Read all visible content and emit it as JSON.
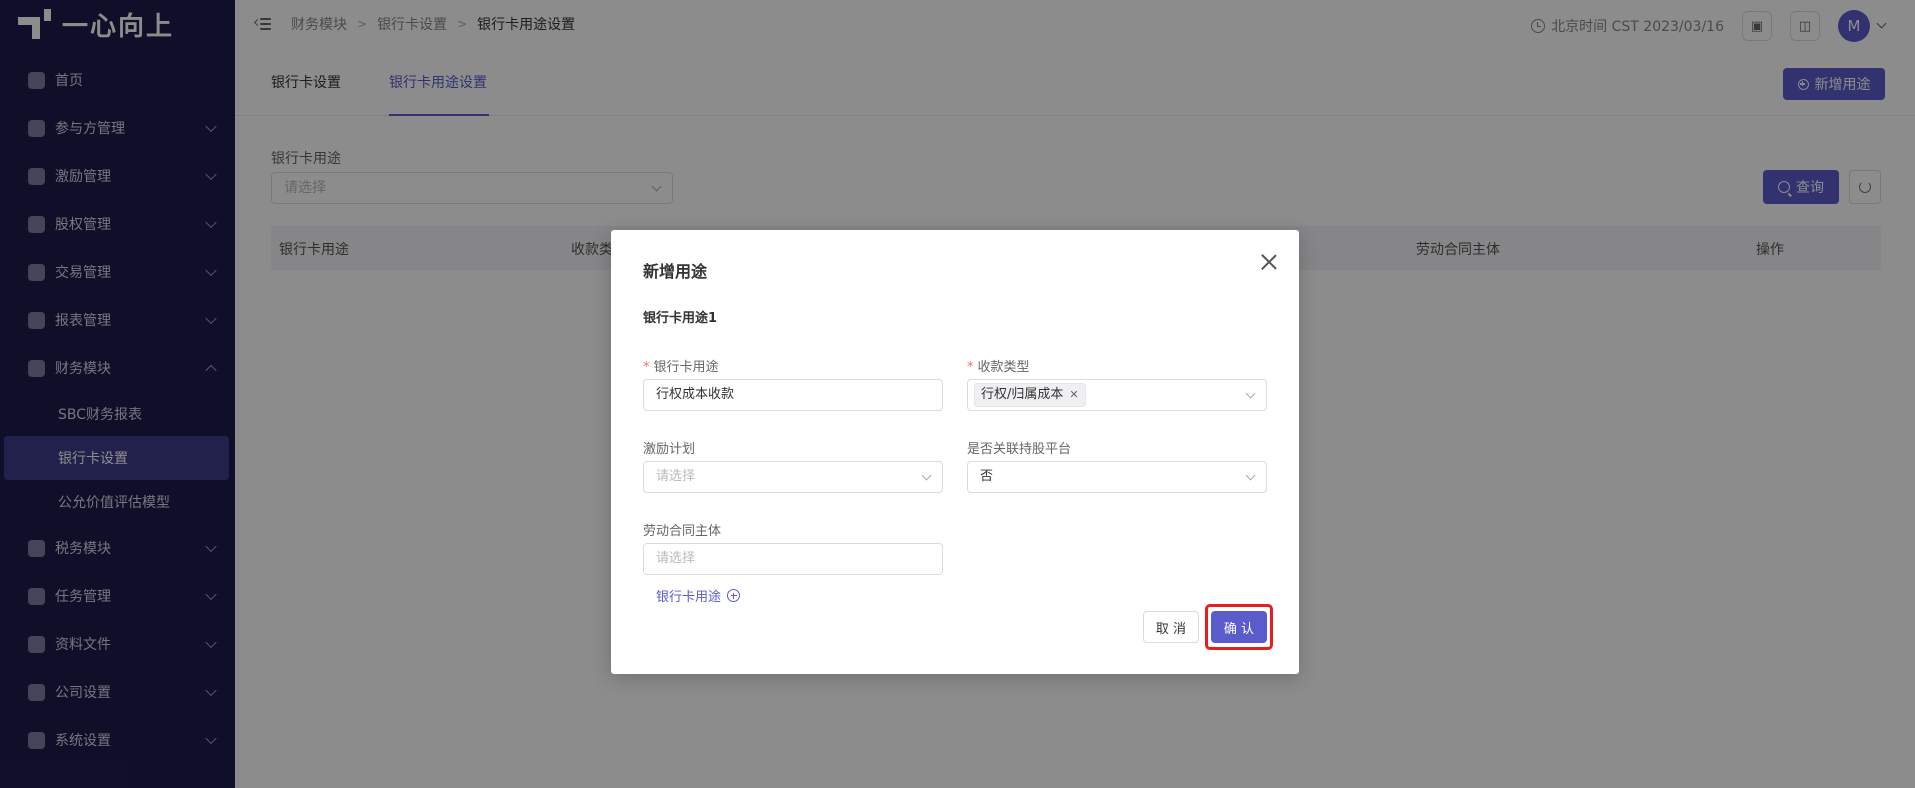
{
  "brand": {
    "name": "一心向上"
  },
  "sidebar": {
    "items": [
      {
        "label": "首页",
        "icon": "home-icon",
        "expandable": false
      },
      {
        "label": "参与方管理",
        "icon": "users-icon",
        "expandable": true
      },
      {
        "label": "激励管理",
        "icon": "star-icon",
        "expandable": true
      },
      {
        "label": "股权管理",
        "icon": "pie-icon",
        "expandable": true
      },
      {
        "label": "交易管理",
        "icon": "exchange-icon",
        "expandable": true
      },
      {
        "label": "报表管理",
        "icon": "report-icon",
        "expandable": true
      },
      {
        "label": "财务模块",
        "icon": "finance-icon",
        "expandable": true,
        "expanded": true,
        "children": [
          {
            "label": "SBC财务报表",
            "active": false
          },
          {
            "label": "银行卡设置",
            "active": true
          },
          {
            "label": "公允价值评估模型",
            "active": false
          }
        ]
      },
      {
        "label": "税务模块",
        "icon": "tax-icon",
        "expandable": true
      },
      {
        "label": "任务管理",
        "icon": "task-icon",
        "expandable": true
      },
      {
        "label": "资料文件",
        "icon": "folder-icon",
        "expandable": true
      },
      {
        "label": "公司设置",
        "icon": "building-icon",
        "expandable": true
      },
      {
        "label": "系统设置",
        "icon": "settings-icon",
        "expandable": true
      }
    ]
  },
  "topbar": {
    "breadcrumb": [
      "财务模块",
      "银行卡设置",
      "银行卡用途设置"
    ],
    "clock": "北京时间 CST 2023/03/16",
    "avatar": "M"
  },
  "page": {
    "tabs": [
      {
        "label": "银行卡设置",
        "active": false
      },
      {
        "label": "银行卡用途设置",
        "active": true
      }
    ],
    "add_button": "新增用途",
    "filter": {
      "label": "银行卡用途",
      "placeholder": "请选择"
    },
    "query_button": "查询",
    "table_headers": [
      "银行卡用途",
      "收款类",
      "劳动合同主体",
      "操作"
    ]
  },
  "modal": {
    "title": "新增用途",
    "section": "银行卡用途1",
    "fields": {
      "bank_card_use": {
        "label": "银行卡用途",
        "required": true,
        "value": "行权成本收款"
      },
      "receipt_type": {
        "label": "收款类型",
        "required": true,
        "tag": "行权/归属成本"
      },
      "incentive_plan": {
        "label": "激励计划",
        "placeholder": "请选择"
      },
      "linked_platform": {
        "label": "是否关联持股平台",
        "value": "否"
      },
      "labor_contract_entity": {
        "label": "劳动合同主体",
        "placeholder": "请选择"
      }
    },
    "add_link": "银行卡用途",
    "cancel": "取 消",
    "confirm": "确 认"
  },
  "colors": {
    "sidebar_bg": "#1d1d4d",
    "primary": "#5a5ccb",
    "highlight": "#e81e1e"
  }
}
